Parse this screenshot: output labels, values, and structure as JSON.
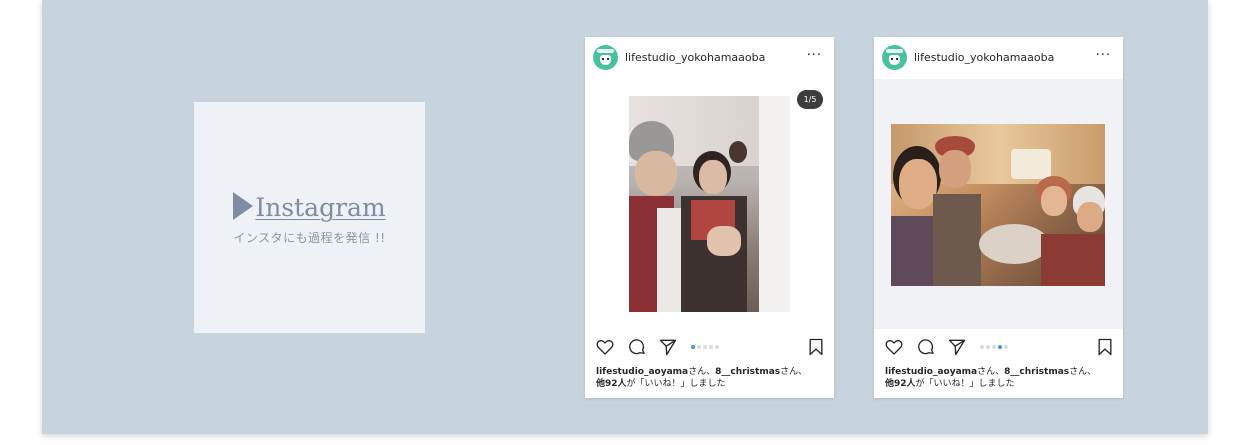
{
  "instagram_card": {
    "link_text": "Instagram",
    "subtitle": "インスタにも過程を発信 !!"
  },
  "posts": [
    {
      "username": "lifestudio_yokohamaaoba",
      "more_label": "···",
      "page_badge": "1/5",
      "carousel_dots": 5,
      "active_dot": 1,
      "likes_user1": "lifestudio_aoyama",
      "likes_text1": "さん、",
      "likes_user2": "8__christmas",
      "likes_text2": "さん、",
      "likes_others": "他92人",
      "likes_text3": "が「いいね！」しました"
    },
    {
      "username": "lifestudio_yokohamaaoba",
      "more_label": "···",
      "carousel_dots": 5,
      "active_dot": 4,
      "likes_user1": "lifestudio_aoyama",
      "likes_text1": "さん、",
      "likes_user2": "8__christmas",
      "likes_text2": "さん、",
      "likes_others": "他92人",
      "likes_text3": "が「いいね！」しました"
    }
  ],
  "icons": {
    "link": "play-triangle-icon",
    "like": "heart-icon",
    "comment": "comment-icon",
    "share": "send-icon",
    "save": "bookmark-icon",
    "avatar": "studio-logo-avatar"
  },
  "colors": {
    "panel_background": "#c7d3dd",
    "card_background": "#eef1f6",
    "link_color": "#7f8ca3",
    "active_dot": "#3897f0",
    "avatar_green": "#46c39a"
  }
}
